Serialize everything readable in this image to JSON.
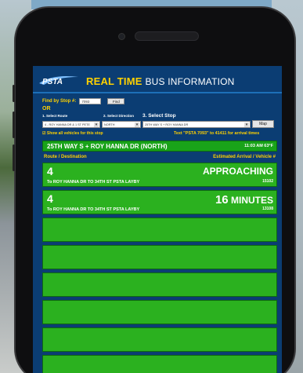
{
  "header": {
    "logo_text": "PSTA",
    "title_highlight": "REAL TIME",
    "title_rest": "BUS INFORMATION"
  },
  "find_stop": {
    "label": "Find by Stop #:",
    "value": "7093",
    "button": "Find"
  },
  "or_label": "OR",
  "selects": {
    "route_label": "1. Select Route",
    "direction_label": "2. Select Direction",
    "stop_label": "3. Select Stop",
    "route_value": "4 - ROY HANNA DR & 1 ST PETE",
    "direction_value": "NORTH",
    "stop_value": "25TH WAY S + ROY HANNA DR",
    "map_button": "Map"
  },
  "options": {
    "show_all": "Show all vehicles for this stop",
    "text_hint": "Text \"PSTA 7093\" to 41411 for arrival times"
  },
  "stop": {
    "name": "25TH WAY S + ROY HANNA DR (NORTH)",
    "time_temp": "11:03 AM  63°F"
  },
  "columns": {
    "left": "Route / Destination",
    "right": "Estimated Arrival / Vehicle #"
  },
  "arrivals": [
    {
      "route": "4",
      "destination": "To ROY HANNA DR TO 34TH ST PSTA LAYBY",
      "eta": "APPROACHING",
      "vehicle": "15102"
    },
    {
      "route": "4",
      "destination": "To ROY HANNA DR TO 34TH ST PSTA LAYBY",
      "eta_number": "16",
      "eta_unit": "MINUTES",
      "vehicle": "13108"
    }
  ],
  "colors": {
    "screen_bg": "#0b3d73",
    "row_green": "#2bb11f",
    "accent_yellow": "#ffd100"
  }
}
